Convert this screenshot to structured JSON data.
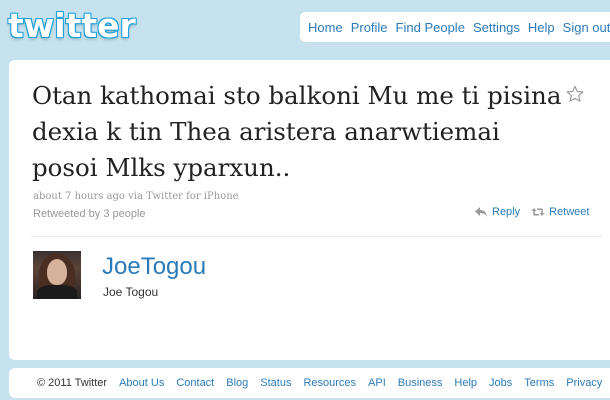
{
  "header": {
    "logo_text": "twitter",
    "nav": [
      "Home",
      "Profile",
      "Find People",
      "Settings",
      "Help",
      "Sign out"
    ]
  },
  "tweet": {
    "text": "Otan kathomai sto balkoni Mu me ti pisina dexia k tin Thea aristera anarwtiemai posoi Mlks yparxun..",
    "time": "about 7 hours ago",
    "via_prefix": "via",
    "source": "Twitter for iPhone",
    "retweeted_by": "Retweeted by 3 people",
    "reply_label": "Reply",
    "retweet_label": "Retweet",
    "favorite_icon": "star-icon"
  },
  "author": {
    "screen_name": "JoeTogou",
    "full_name": "Joe Togou"
  },
  "footer": {
    "copyright": "© 2011 Twitter",
    "links": [
      "About Us",
      "Contact",
      "Blog",
      "Status",
      "Resources",
      "API",
      "Business",
      "Help",
      "Jobs",
      "Terms",
      "Privacy"
    ]
  },
  "colors": {
    "background": "#c6e2ee",
    "link": "#2b7bb9",
    "text": "#222222",
    "muted": "#999999"
  }
}
